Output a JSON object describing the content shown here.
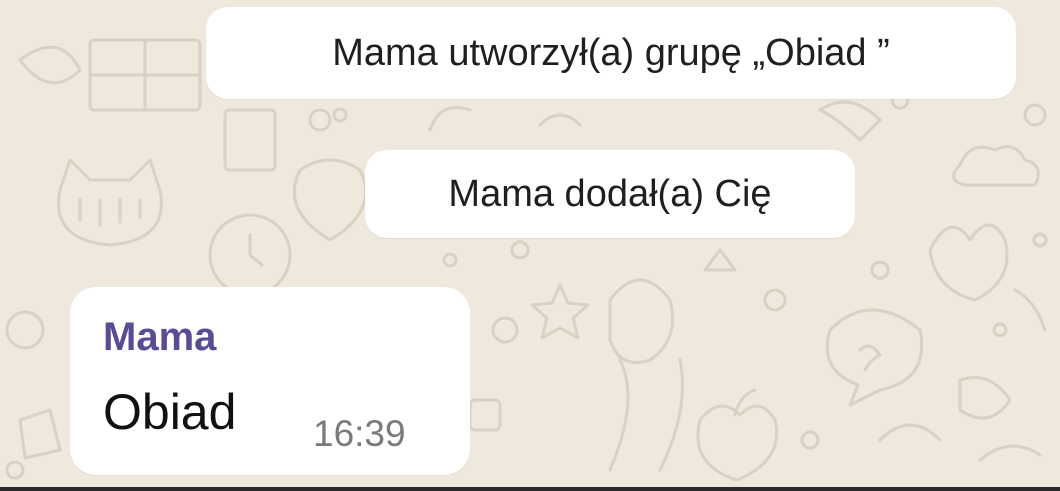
{
  "chat": {
    "background_color": "#efe8dd",
    "system_messages": [
      {
        "text": "Mama utworzył(a) grupę „Obiad ”"
      },
      {
        "text": "Mama dodał(a) Cię"
      }
    ],
    "message": {
      "sender": "Mama",
      "sender_color": "#5b4b93",
      "text": "Obiad",
      "time": "16:39"
    }
  }
}
